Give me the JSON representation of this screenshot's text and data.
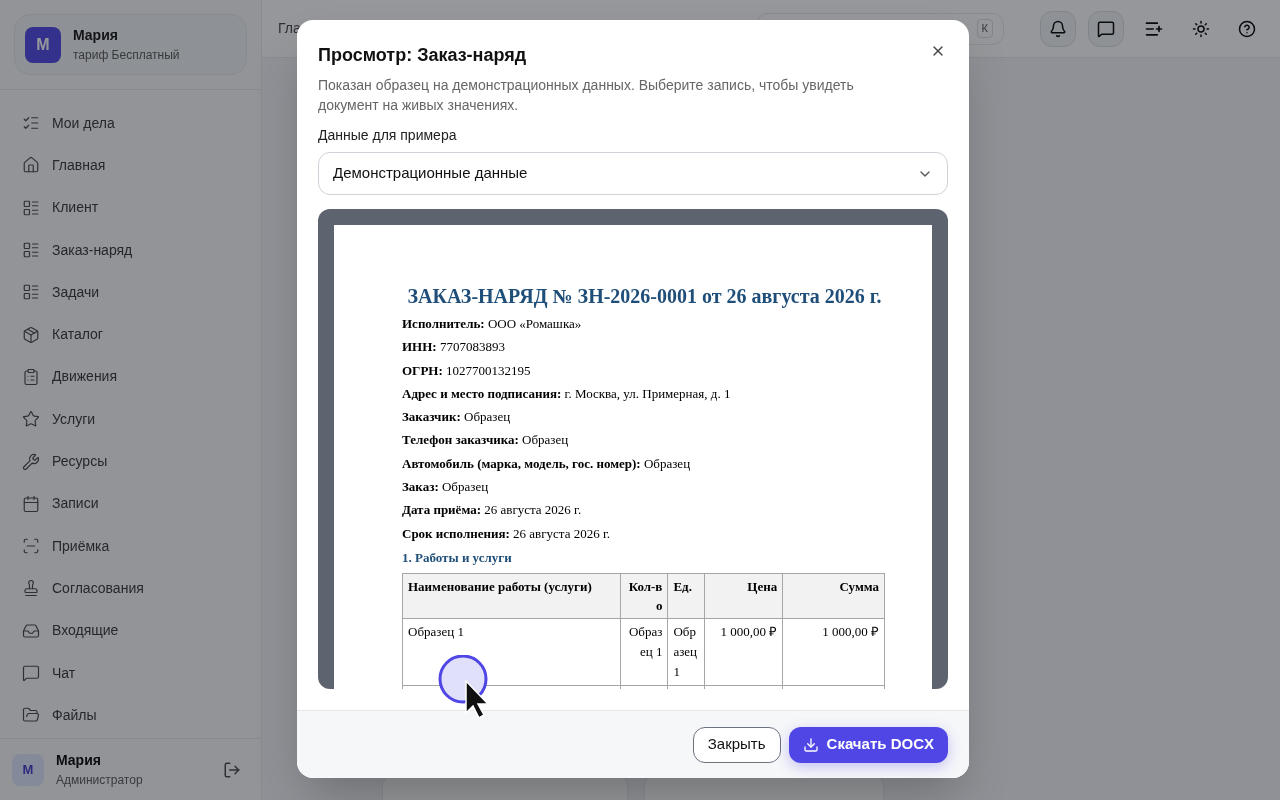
{
  "sidebar": {
    "profile": {
      "avatar": "М",
      "name": "Мария",
      "plan": "тариф Бесплатный"
    },
    "items": [
      {
        "label": "Мои дела"
      },
      {
        "label": "Главная"
      },
      {
        "label": "Клиент"
      },
      {
        "label": "Заказ-наряд"
      },
      {
        "label": "Задачи"
      },
      {
        "label": "Каталог"
      },
      {
        "label": "Движения"
      },
      {
        "label": "Услуги"
      },
      {
        "label": "Ресурсы"
      },
      {
        "label": "Записи"
      },
      {
        "label": "Приёмка"
      },
      {
        "label": "Согласования"
      },
      {
        "label": "Входящие"
      },
      {
        "label": "Чат"
      },
      {
        "label": "Файлы"
      }
    ],
    "user": {
      "avatar": "М",
      "name": "Мария",
      "role": "Администратор"
    }
  },
  "topbar": {
    "breadcrumb": "Гла",
    "search_shortcut": "К"
  },
  "dialog": {
    "title": "Просмотр: Заказ-наряд",
    "description": "Показан образец на демонстрационных данных. Выберите запись, чтобы увидеть документ на живых значениях.",
    "select_label": "Данные для примера",
    "select_value": "Демонстрационные данные",
    "document": {
      "title": "ЗАКАЗ-НАРЯД № ЗН-2026-0001 от 26 августа 2026 г.",
      "fields": [
        "**Исполнитель:** ООО «Ромашка»",
        "**ИНН:** 7707083893",
        "**ОГРН:** 1027700132195",
        "**Адрес и место подписания:** г. Москва, ул. Примерная, д. 1",
        "**Заказчик:** Образец",
        "**Телефон заказчика:** Образец",
        "**Автомобиль (марка, модель, гос. номер):** Образец",
        "**Заказ:** Образец",
        "**Дата приёма:** 26 августа 2026 г.",
        "**Срок исполнения:** 26 августа 2026 г."
      ],
      "section_title": "1. Работы и услуги",
      "table": {
        "columns": [
          "Наименование работы (услуги)",
          "Кол-во",
          "Ед.",
          "Цена",
          "Сумма"
        ],
        "rows": [
          [
            "Образец 1",
            "Образец 1",
            "Образец 1",
            "1 000,00 ₽",
            "1 000,00 ₽"
          ]
        ]
      }
    },
    "buttons": [
      {
        "label": "Закрыть",
        "kind": "secondary"
      },
      {
        "label": "Скачать DOCX",
        "kind": "primary"
      }
    ]
  }
}
